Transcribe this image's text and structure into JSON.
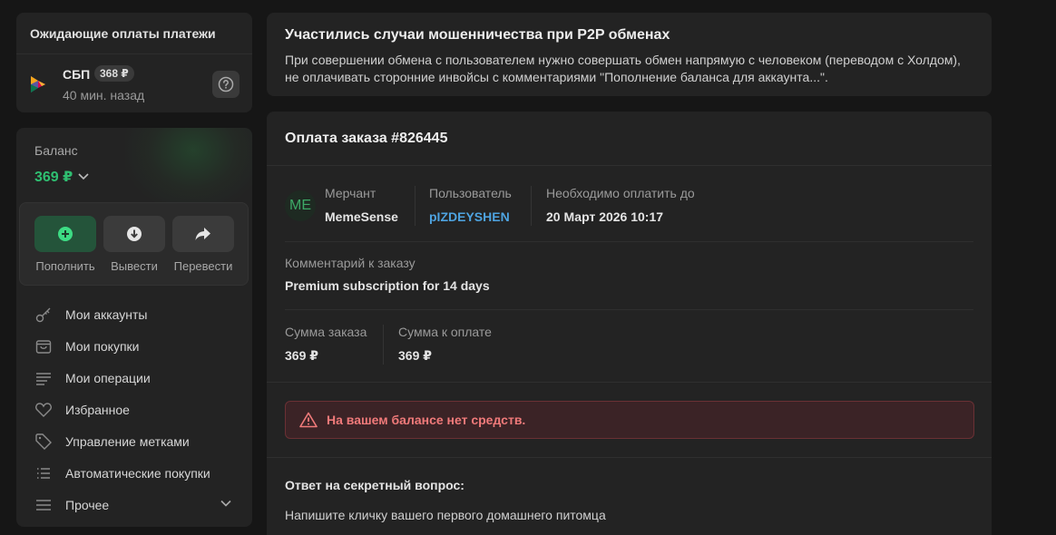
{
  "pending": {
    "title": "Ожидающие оплаты платежи",
    "method_name": "СБП",
    "amount_badge": "368 ₽",
    "time_ago": "40 мин. назад",
    "help_icon": "question-circle-icon"
  },
  "balance": {
    "label": "Баланс",
    "value": "369 ₽",
    "accent_color": "#2fbf71",
    "actions": [
      {
        "label": "Пополнить",
        "icon": "plus-circle-icon"
      },
      {
        "label": "Вывести",
        "icon": "arrow-down-circle-icon"
      },
      {
        "label": "Перевести",
        "icon": "share-arrow-icon"
      }
    ]
  },
  "menu": {
    "items": [
      {
        "label": "Мои аккаунты",
        "icon": "key-icon"
      },
      {
        "label": "Мои покупки",
        "icon": "shopping-bag-icon"
      },
      {
        "label": "Мои операции",
        "icon": "lines-icon"
      },
      {
        "label": "Избранное",
        "icon": "heart-icon"
      },
      {
        "label": "Управление метками",
        "icon": "tag-icon"
      },
      {
        "label": "Автоматические покупки",
        "icon": "list-icon"
      },
      {
        "label": "Прочее",
        "icon": "menu-icon"
      }
    ]
  },
  "notice": {
    "title": "Участились случаи мошенничества при P2P обменах",
    "text": "При совершении обмена с пользователем нужно совершать обмен напрямую с человеком (переводом с Холдом), не оплачивать сторонние инвойсы с комментариями \"Пополнение баланса для аккаунта...\"."
  },
  "order": {
    "title": "Оплата заказа #826445",
    "merchant_initials": "ME",
    "merchant_label": "Мерчант",
    "merchant_value": "MemeSense",
    "user_label": "Пользователь",
    "user_value": "pIZDEYSHEN",
    "deadline_label": "Необходимо оплатить до",
    "deadline_value": "20 Март 2026 10:17",
    "comment_label": "Комментарий к заказу",
    "comment_value": "Premium subscription for 14 days",
    "sum_label": "Сумма заказа",
    "sum_value": "369 ₽",
    "pay_label": "Сумма к оплате",
    "pay_value": "369 ₽",
    "alert_text": "На вашем балансе нет средств.",
    "alert_color": "#f07a7a",
    "secret_title": "Ответ на секретный вопрос:",
    "secret_text": "Напишите кличку вашего первого домашнего питомца"
  }
}
